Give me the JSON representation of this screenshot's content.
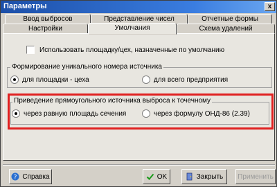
{
  "window": {
    "title": "Параметры",
    "close_label": "x"
  },
  "tabs": {
    "row1": [
      "Ввод выбросов",
      "Представление чисел",
      "Отчетные формы"
    ],
    "row2": [
      "Настройки",
      "Умолчания",
      "Схема удалений"
    ]
  },
  "checkbox_default_area": {
    "label": "Использовать площадку/цех, назначенные по умолчанию",
    "checked": false
  },
  "group_id_formation": {
    "title": "Формирование уникального номера источника",
    "options": [
      {
        "label": "для площадки - цеха",
        "checked": true
      },
      {
        "label": "для всего предприятия",
        "checked": false
      }
    ]
  },
  "group_rect_to_point": {
    "title": "Приведение прямоугольного источника выброса к точечному",
    "options": [
      {
        "label": "через равную площадь сечения",
        "checked": true
      },
      {
        "label": "через формулу  ОНД-86   (2.39)",
        "checked": false
      }
    ]
  },
  "buttons": {
    "help": "Справка",
    "ok": "OK",
    "close": "Закрыть",
    "apply": "Применить"
  },
  "colors": {
    "highlight": "#e02020",
    "title_bar": "#1c4fa8"
  }
}
